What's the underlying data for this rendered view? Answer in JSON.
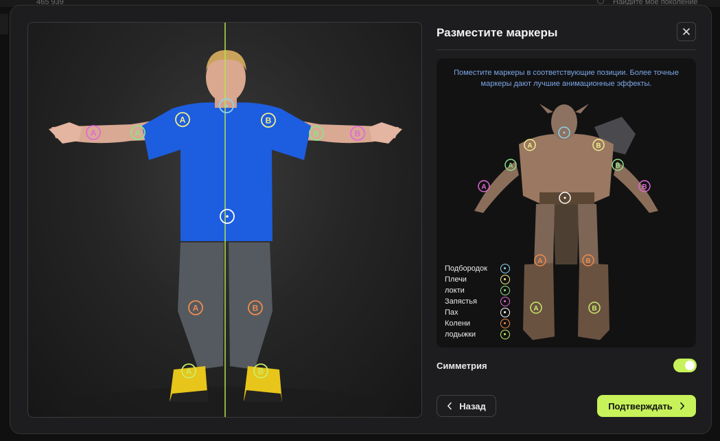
{
  "background": {
    "count_text": "465 939",
    "search_placeholder": "Найдите мое поколение"
  },
  "dialog": {
    "title": "Разместите маркеры",
    "hint": "Поместите маркеры в соответствующие позиции. Более точные маркеры дают лучшие анимационные эффекты.",
    "symmetry_label": "Симметрия",
    "symmetry_on": true,
    "back_label": "Назад",
    "confirm_label": "Подтверждать"
  },
  "legend": [
    {
      "label": "Подбородок",
      "color": "#8fd3ea"
    },
    {
      "label": "Плечи",
      "color": "#f3ee8a"
    },
    {
      "label": "локти",
      "color": "#8fe28a"
    },
    {
      "label": "Запястья",
      "color": "#e06ad6"
    },
    {
      "label": "Пах",
      "color": "#ffffff"
    },
    {
      "label": "Колени",
      "color": "#f08c4c"
    },
    {
      "label": "лодыжки",
      "color": "#c7ee6a"
    }
  ],
  "marker_letters": {
    "left": "A",
    "right": "B"
  },
  "colors": {
    "accent": "#c7f25a",
    "symmetry_line": "#b7e34c",
    "shirt": "#1d5de0"
  }
}
